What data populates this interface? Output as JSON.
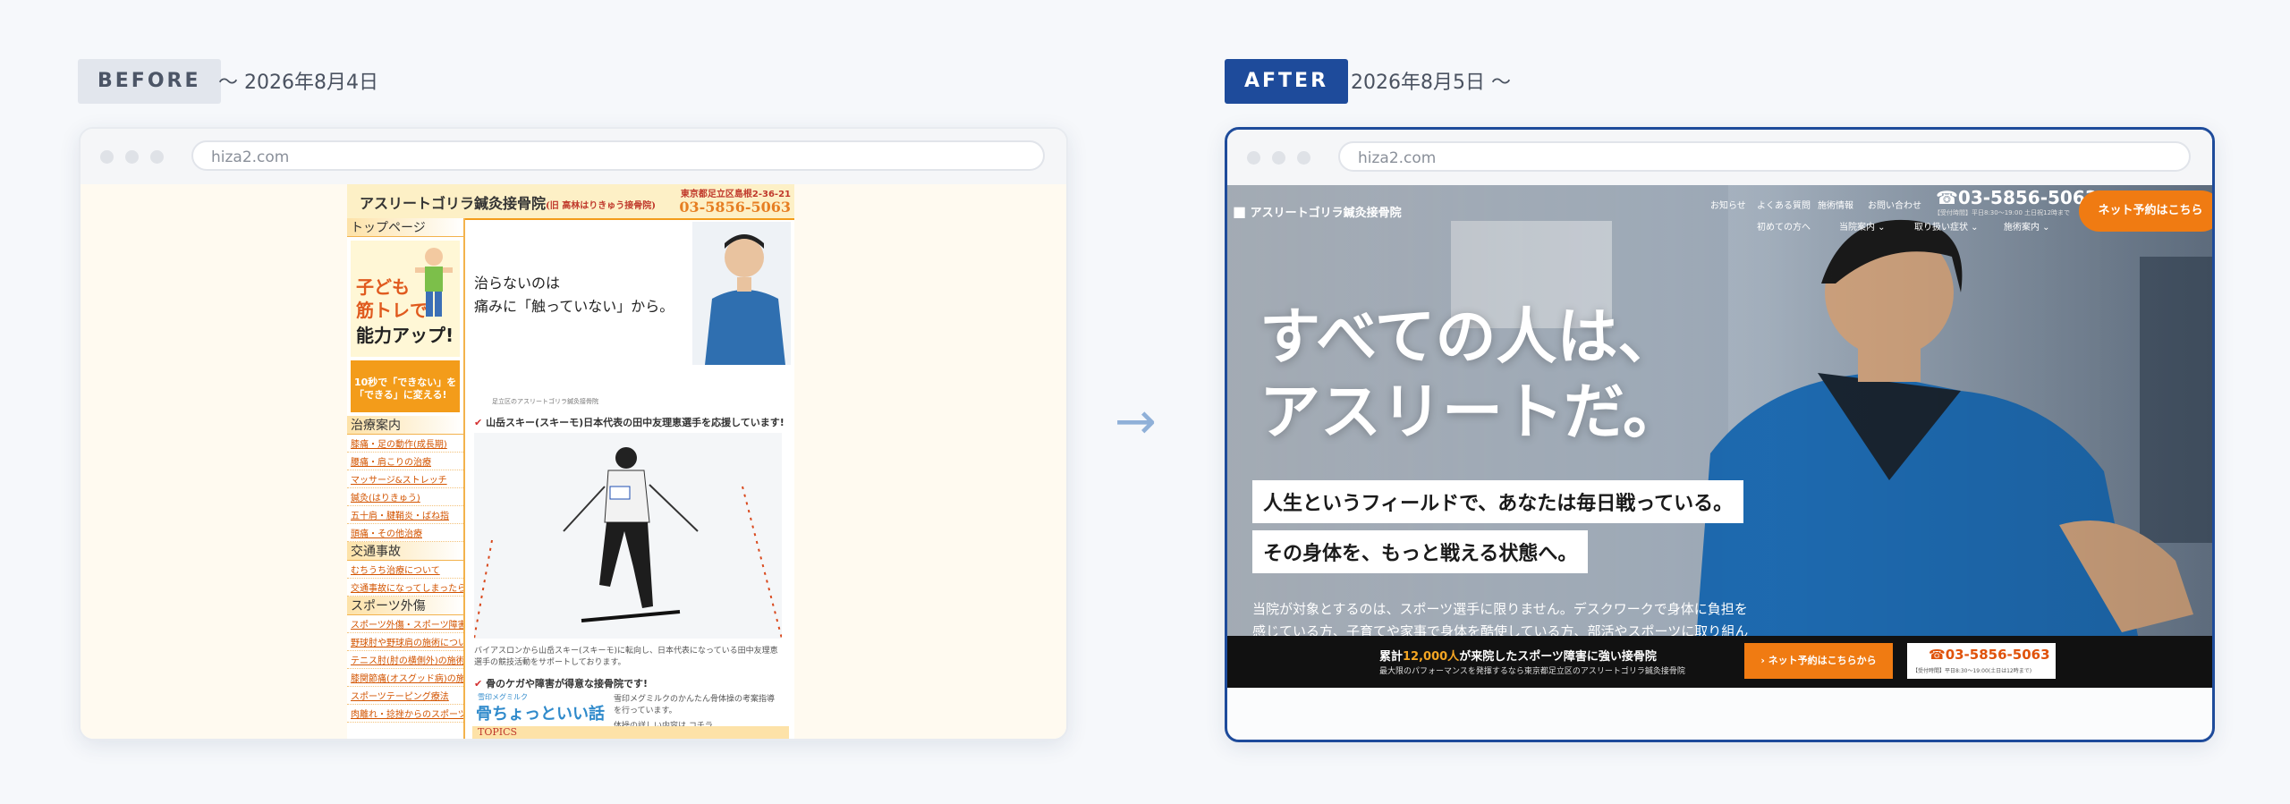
{
  "before": {
    "tag": "BEFORE",
    "date": "〜 2026年8月4日"
  },
  "after": {
    "tag": "AFTER",
    "date": "2026年8月5日 〜"
  },
  "arrow": "→",
  "browser_url": "hiza2.com",
  "old_site": {
    "title": "アスリートゴリラ鍼灸接骨院",
    "title_sub": "(旧 高林はりきゅう接骨院)",
    "address": "東京都足立区島根2-36-21",
    "tel": "03-5856-5063",
    "top_page": "トップページ",
    "kids_lines": [
      "子ども",
      "筋トレで",
      "能力アップ!"
    ],
    "promo": "10秒で「できない」を「できる」に変える!",
    "sections": [
      {
        "head": "治療案内",
        "links": [
          "膝痛・足の動作(成長期)",
          "腰痛・肩こりの治療",
          "マッサージ&ストレッチ",
          "鍼灸(はりきゅう)",
          "五十肩・腱鞘炎・ばね指",
          "頭痛・その他治療"
        ]
      },
      {
        "head": "交通事故",
        "links": [
          "むちうち治療について",
          "交通事故になってしまったら"
        ]
      },
      {
        "head": "スポーツ外傷",
        "links": [
          "スポーツ外傷・スポーツ障害",
          "野球肘や野球肩の施術について",
          "テニス肘(肘の横側外)の施術",
          "膝関節痛(オスグッド病)の施術",
          "スポーツテーピング療法",
          "肉離れ・捻挫からのスポーツ復帰"
        ]
      }
    ],
    "catch_lines": [
      "治らないのは",
      "痛みに「触っていない」から。"
    ],
    "photo_caption": "足立区のアスリートゴリラ鍼灸接骨院",
    "news_heading": "山岳スキー(スキーモ)日本代表の田中友理恵選手を応援しています!",
    "news_body": "バイアスロンから山岳スキー(スキーモ)に転向し、日本代表になっている田中友理恵選手の競技活動をサポートしております。",
    "news2_heading": "骨のケガや障害が得意な接骨院です!",
    "news2_body": "雪印メグミルクのかんたん骨体操の考案指導を行っています。",
    "news2_detail": "体操の詳しい内容は コチラ",
    "bone_brand": "雪印メグミルク",
    "bone_title": "骨ちょっといい話",
    "topics": "TOPICS"
  },
  "new_site": {
    "logo": "アスリートゴリラ鍼灸接骨院",
    "nav_top": [
      "お知らせ",
      "よくある質問",
      "施術情報",
      "お問い合わせ"
    ],
    "nav_bottom": [
      "初めての方へ",
      "当院案内 ⌄",
      "取り扱い症状 ⌄",
      "施術案内 ⌄"
    ],
    "tel": "03-5856-5063",
    "hours": "【受付時間】平日8:30〜19:00 土日祝12時まで",
    "cta": "ネット予約はこちら",
    "headline_lines": [
      "すべての人は、",
      "アスリートだ。"
    ],
    "sub1": "人生というフィールドで、あなたは毎日戦っている。",
    "sub2": "その身体を、もっと戦える状態へ。",
    "body": "当院が対象とするのは、スポーツ選手に限りません。デスクワークで身体に負担を感じている方、子育てや家事で身体を酷使している方、部活やスポーツに取り組んでいる方など、人生というフィールドで戦う全ての人を応援しています。",
    "bar_line1_prefix": "累計",
    "bar_line1_highlight": "12,000人",
    "bar_line1_suffix": "が来院したスポーツ障害に強い接骨院",
    "bar_line2": "最大限のパフォーマンスを発揮するなら東京都足立区のアスリートゴリラ鍼灸接骨院",
    "bar_cta": "ネット予約はこちらから",
    "bar_tel": "03-5856-5063",
    "bar_hours": "【受付時間】平日8:30〜19:00(土日は12時まで)"
  },
  "colors": {
    "accent": "#1e4b9b",
    "orange": "#f07b12",
    "old_orange": "#f39c1a"
  }
}
